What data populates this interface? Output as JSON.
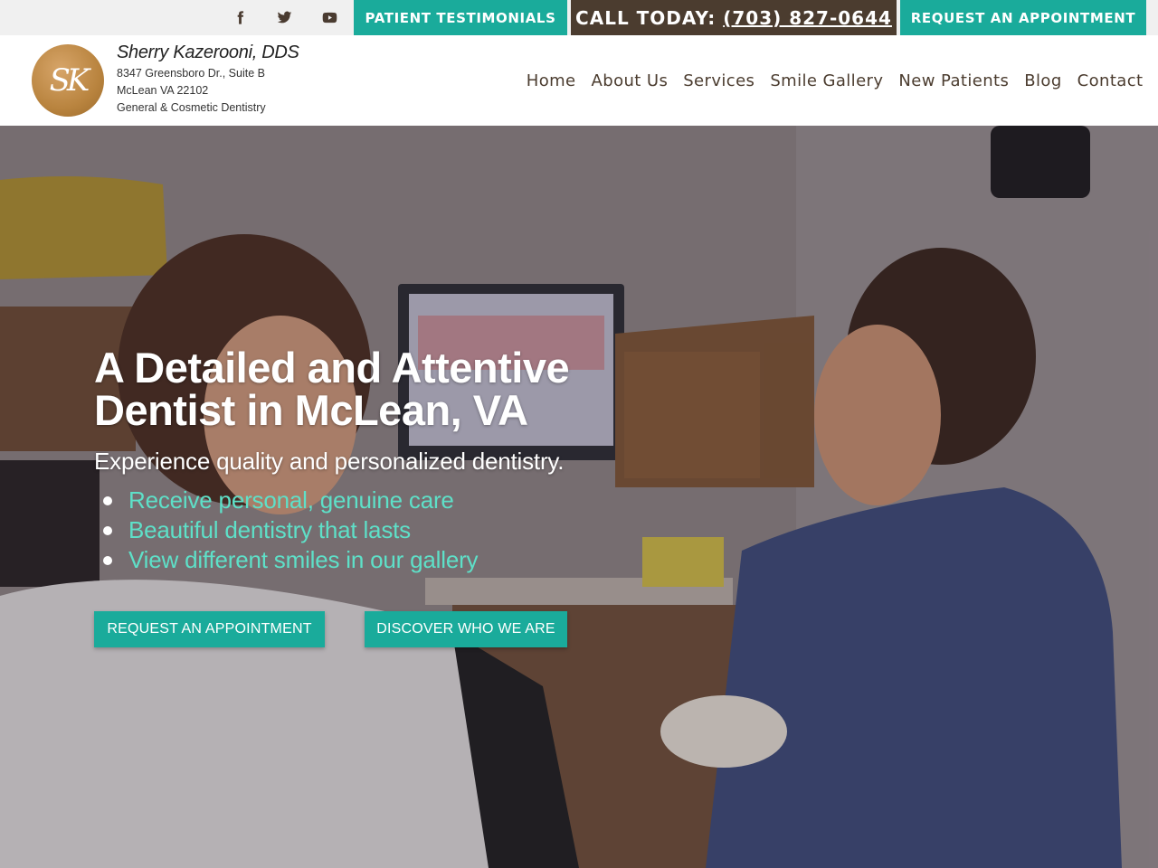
{
  "colors": {
    "accent": "#1aab9b",
    "brand_brown": "#4b3c2f",
    "bullet_link": "#5ee0c8"
  },
  "topbar": {
    "social": [
      {
        "name": "facebook-icon"
      },
      {
        "name": "twitter-icon"
      },
      {
        "name": "youtube-icon"
      }
    ],
    "testimonials_label": "PATIENT TESTIMONIALS",
    "call_label": "CALL TODAY:",
    "phone": "(703) 827-0644",
    "appointment_label": "REQUEST AN APPOINTMENT"
  },
  "header": {
    "logo_initials": "SK",
    "name": "Sherry Kazerooni, DDS",
    "address1": "8347 Greensboro Dr., Suite B",
    "address2": "McLean VA 22102",
    "tagline": "General & Cosmetic Dentistry",
    "nav": [
      "Home",
      "About Us",
      "Services",
      "Smile Gallery",
      "New Patients",
      "Blog",
      "Contact"
    ]
  },
  "hero": {
    "headline_line1": "A Detailed and Attentive",
    "headline_line2": "Dentist in McLean, VA",
    "subhead": "Experience quality and personalized dentistry.",
    "bullets": [
      "Receive personal, genuine care",
      "Beautiful dentistry that lasts",
      "View different smiles in our gallery"
    ],
    "cta_primary": "REQUEST AN APPOINTMENT",
    "cta_secondary": "DISCOVER WHO WE ARE"
  }
}
